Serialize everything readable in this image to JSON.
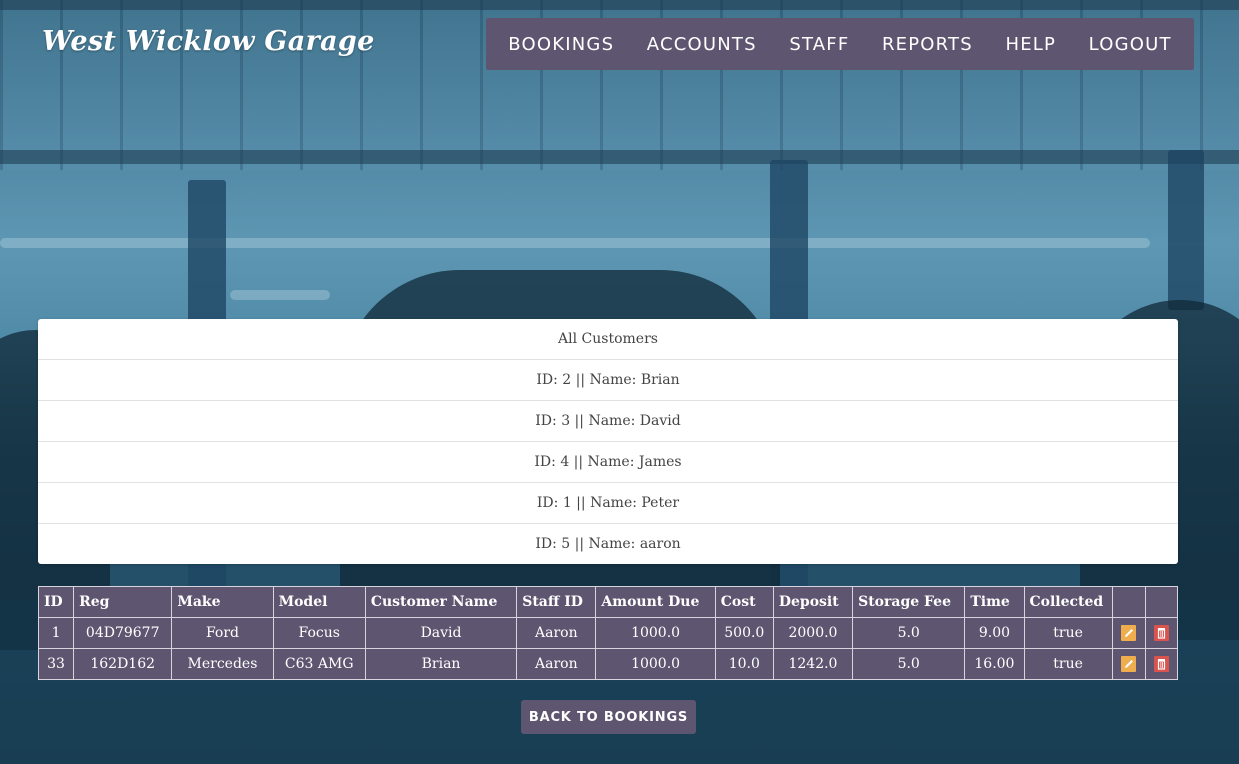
{
  "brand": {
    "name": "West Wicklow Garage"
  },
  "nav": {
    "items": [
      {
        "label": "BOOKINGS"
      },
      {
        "label": "ACCOUNTS"
      },
      {
        "label": "STAFF"
      },
      {
        "label": "REPORTS"
      },
      {
        "label": "HELP"
      },
      {
        "label": "LOGOUT"
      }
    ]
  },
  "customers": {
    "header": "All Customers",
    "rows": [
      "ID: 2 || Name: Brian",
      "ID: 3 || Name: David",
      "ID: 4 || Name: James",
      "ID: 1 || Name: Peter",
      "ID: 5 || Name: aaron"
    ]
  },
  "table": {
    "columns": [
      "ID",
      "Reg",
      "Make",
      "Model",
      "Customer Name",
      "Staff ID",
      "Amount Due",
      "Cost",
      "Deposit",
      "Storage Fee",
      "Time",
      "Collected"
    ],
    "rows": [
      [
        "1",
        "04D79677",
        "Ford",
        "Focus",
        "David",
        "Aaron",
        "1000.0",
        "500.0",
        "2000.0",
        "5.0",
        "9.00",
        "true"
      ],
      [
        "33",
        "162D162",
        "Mercedes",
        "C63 AMG",
        "Brian",
        "Aaron",
        "1000.0",
        "10.0",
        "1242.0",
        "5.0",
        "16.00",
        "true"
      ]
    ],
    "action_icons": [
      "pencil-icon",
      "trash-icon"
    ]
  },
  "footer": {
    "back_label": "BACK TO BOOKINGS"
  },
  "colors": {
    "nav_bg": "#5e5670",
    "edit_icon": "#f0ad4e",
    "delete_icon": "#d9534f"
  }
}
